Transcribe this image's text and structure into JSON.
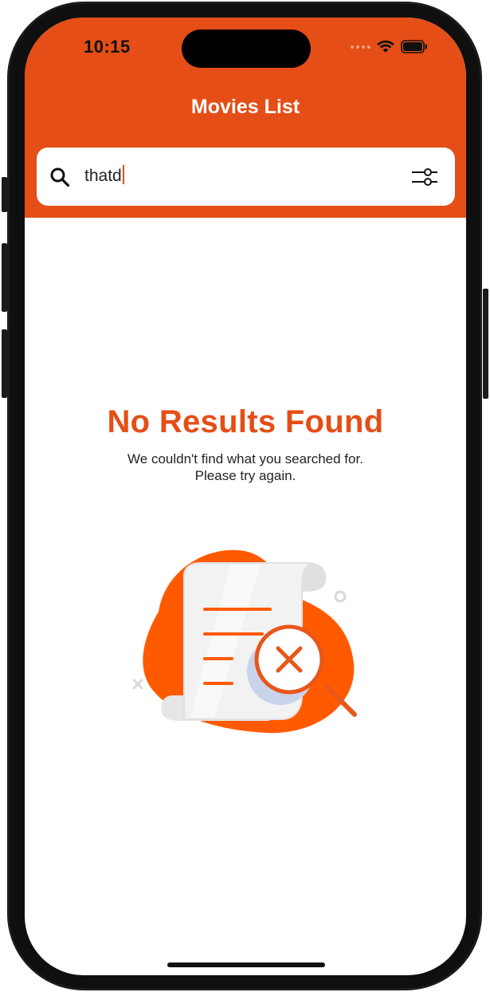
{
  "status_bar": {
    "time": "10:15"
  },
  "header": {
    "title": "Movies List",
    "background_color": "#e54e17"
  },
  "search": {
    "value": "thatd",
    "placeholder": "",
    "search_icon": "search-icon",
    "filter_icon": "sliders-icon"
  },
  "empty_state": {
    "title": "No Results Found",
    "message_line1": "We couldn't find what you searched for.",
    "message_line2": "Please try again.",
    "illustration_icon": "document-search-not-found-icon",
    "accent_color": "#ff5a00"
  }
}
